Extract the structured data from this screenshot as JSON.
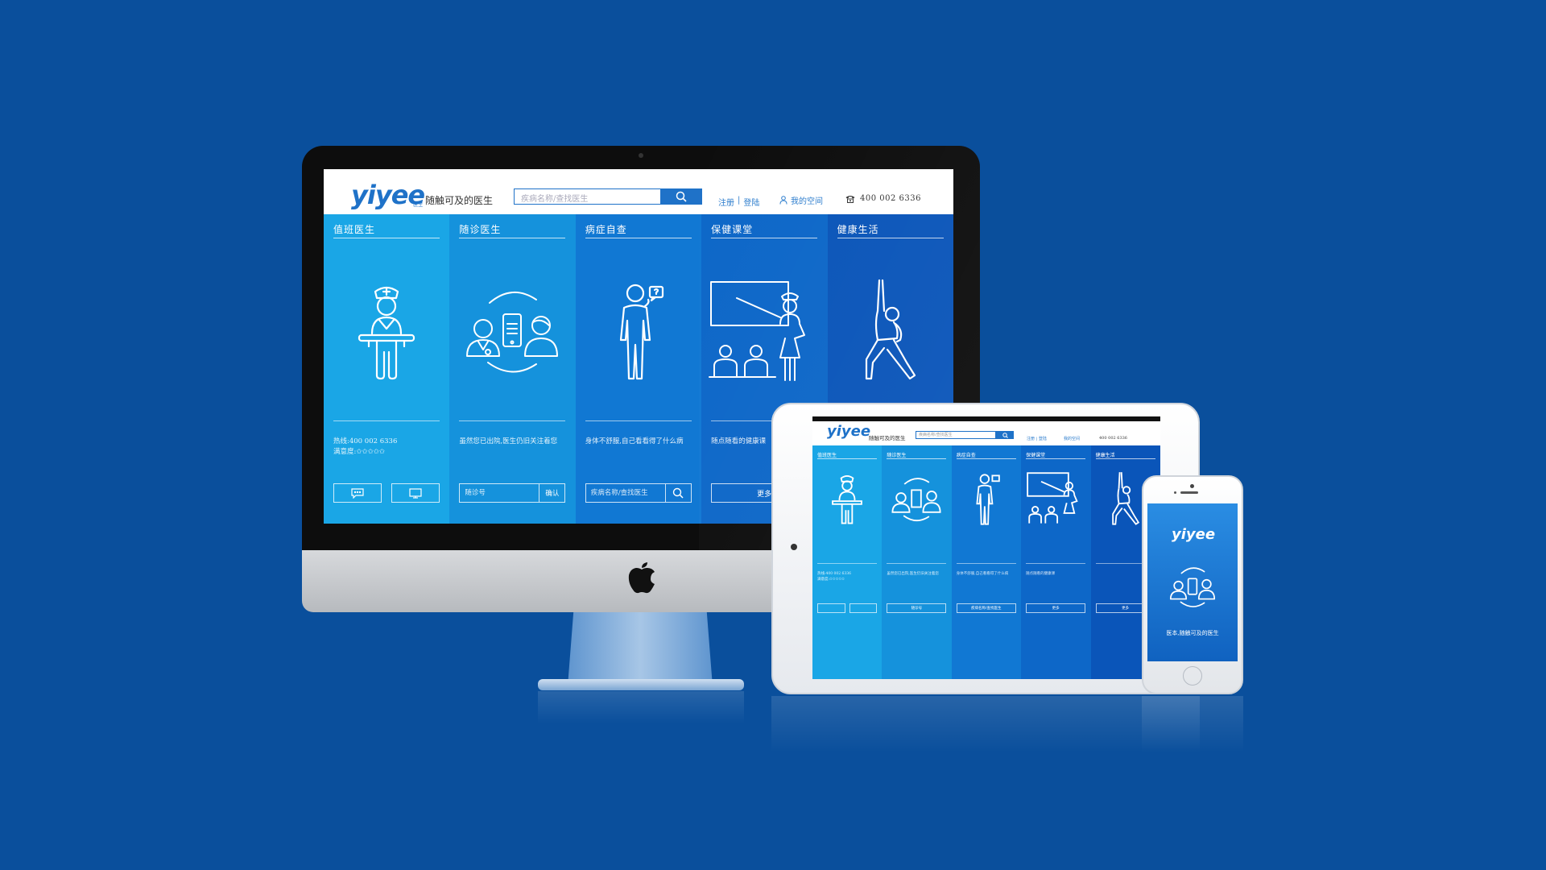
{
  "brand": {
    "logo_text": "yiyee",
    "logo_sub": "医生",
    "slogan": "随触可及的医生"
  },
  "header": {
    "search_placeholder": "疾病名称/查找医生",
    "register_label": "注册",
    "separator": "|",
    "login_label": "登陆",
    "my_space_label": "我的空间",
    "phone": "400 002 6336"
  },
  "panels": [
    {
      "title": "值班医生",
      "color": "#1aa6e6",
      "icon": "nurse-at-desk-icon",
      "hotline_label": "热线:400 002 6336",
      "rating_label": "满意度:",
      "rating_stars": "✩✩✩✩✩",
      "buttons": [
        "chat-icon",
        "monitor-icon"
      ]
    },
    {
      "title": "随诊医生",
      "color": "#1592dc",
      "icon": "doctor-phone-patient-icon",
      "desc": "虽然您已出院,医生仍旧关注着您",
      "input_placeholder": "随诊号",
      "confirm_label": "确认"
    },
    {
      "title": "病症自查",
      "color": "#1178d3",
      "icon": "person-question-icon",
      "desc": "身体不舒服,自己看看得了什么病",
      "input_placeholder": "疾病名称/查找医生"
    },
    {
      "title": "保健课堂",
      "color": "#0d67c8",
      "icon": "classroom-icon",
      "desc": "随点随看的健康课",
      "more_label": "更多"
    },
    {
      "title": "健康生活",
      "color": "#0a55b9",
      "icon": "exercise-person-icon",
      "desc": "",
      "more_label": "更多"
    }
  ],
  "ipad": {
    "slogan": "随触可及的医生",
    "search_placeholder": "疾病名称/查找医生",
    "header_links": "注册 | 登陆",
    "my_space": "我的空间",
    "phone": "400 002 6336",
    "more_label": "更多"
  },
  "iphone": {
    "logo_text": "yiyee",
    "tagline": "医本,随触可及的医生"
  },
  "colors": {
    "background": "#0a4f9c",
    "accent": "#1f72c8"
  }
}
